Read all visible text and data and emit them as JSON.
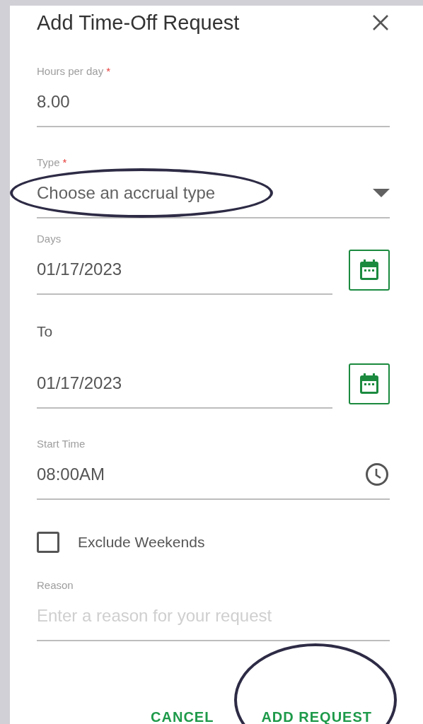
{
  "dialog": {
    "title": "Add Time-Off Request"
  },
  "fields": [
    {
      "kind": "text",
      "label": "Hours per day",
      "floating_label": true,
      "required_mark": "*",
      "value": "8.00"
    },
    {
      "kind": "select",
      "label": "Type",
      "floating_label": true,
      "required_mark": "*",
      "placeholder": "Choose an accrual type"
    },
    {
      "kind": "date",
      "label": "Days",
      "floating_label": true,
      "value": "01/17/2023"
    },
    {
      "kind": "date",
      "label": "To",
      "floating_label": false,
      "value": "01/17/2023"
    },
    {
      "kind": "time",
      "label": "Start Time",
      "floating_label": true,
      "value": "08:00AM"
    },
    {
      "kind": "checkbox",
      "label": "Exclude Weekends",
      "checked": false
    },
    {
      "kind": "text",
      "label": "Reason",
      "floating_label": true,
      "placeholder": "Enter a reason for your request"
    }
  ],
  "buttons": [
    {
      "label": "CANCEL"
    },
    {
      "label": "ADD REQUEST"
    }
  ]
}
